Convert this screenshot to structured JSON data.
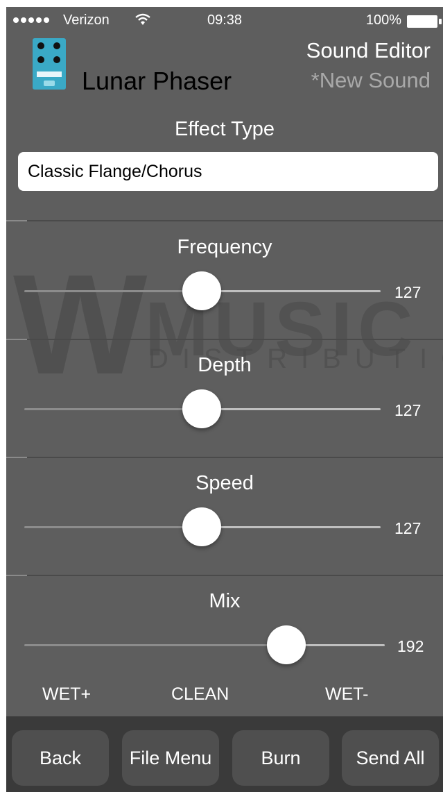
{
  "status_bar": {
    "carrier": "Verizon",
    "time": "09:38",
    "battery": "100%"
  },
  "header": {
    "product_name": "Lunar Phaser",
    "screen_title": "Sound Editor",
    "sound_name": "*New Sound"
  },
  "effect": {
    "label": "Effect Type",
    "value": "Classic Flange/Chorus"
  },
  "sliders": [
    {
      "label": "Frequency",
      "value": "127",
      "level": 127,
      "max": 255
    },
    {
      "label": "Depth",
      "value": "127",
      "level": 127,
      "max": 255
    },
    {
      "label": "Speed",
      "value": "127",
      "level": 127,
      "max": 255
    },
    {
      "label": "Mix",
      "value": "192",
      "level": 192,
      "max": 255
    }
  ],
  "mix_scale": {
    "left": "WET+",
    "center": "CLEAN",
    "right": "WET-"
  },
  "watermark": {
    "logo": "W",
    "brand": "MUSIC",
    "tagline": "DISTRIBUTION"
  },
  "toolbar": {
    "back": "Back",
    "file_menu": "File Menu",
    "burn": "Burn",
    "send_all": "Send All"
  }
}
